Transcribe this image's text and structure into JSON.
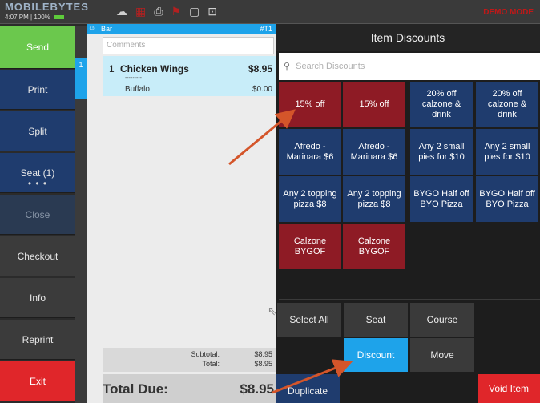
{
  "topbar": {
    "brand": "MOBILEBYTES",
    "time": "4:07 PM",
    "battery_pct": "100%",
    "mode": "DEMO MODE",
    "icons": [
      "cloud-upload-icon",
      "grid-icon",
      "printer-icon",
      "flag-icon",
      "chat-icon",
      "terminal-icon"
    ]
  },
  "nav": {
    "send": "Send",
    "print": "Print",
    "split": "Split",
    "seat": "Seat (1)",
    "seat_more": "• • •",
    "close": "Close",
    "checkout": "Checkout",
    "info": "Info",
    "reprint": "Reprint",
    "exit": "Exit"
  },
  "seat_strip": {
    "active_seat": "1"
  },
  "order": {
    "location": "Bar",
    "table": "#T1",
    "comments_placeholder": "Comments",
    "items": [
      {
        "qty": "1",
        "name": "Chicken Wings",
        "price": "$8.95",
        "separator": "---------",
        "modifier": "Buffalo",
        "modifier_price": "$0.00"
      }
    ],
    "subtotal_label": "Subtotal:",
    "subtotal": "$8.95",
    "total_label": "Total:",
    "total": "$8.95",
    "total_due_label": "Total Due:",
    "total_due": "$8.95"
  },
  "discounts": {
    "title": "Item Discounts",
    "search_placeholder": "Search Discounts",
    "tiles": [
      {
        "label": "15% off",
        "color": "#8e1b25"
      },
      {
        "label": "15% off",
        "color": "#8e1b25"
      },
      {
        "label": "20% off calzone & drink",
        "color": "#1f3c6e"
      },
      {
        "label": "20% off calzone & drink",
        "color": "#1f3c6e"
      },
      {
        "label": "Afredo - Marinara $6",
        "color": "#1f3c6e"
      },
      {
        "label": "Afredo - Marinara $6",
        "color": "#1f3c6e"
      },
      {
        "label": "Any 2 small pies for $10",
        "color": "#1f3c6e"
      },
      {
        "label": "Any 2 small pies for $10",
        "color": "#1f3c6e"
      },
      {
        "label": "Any 2 topping pizza $8",
        "color": "#1f3c6e"
      },
      {
        "label": "Any 2 topping pizza $8",
        "color": "#1f3c6e"
      },
      {
        "label": "BYGO Half off BYO Pizza",
        "color": "#1f3c6e"
      },
      {
        "label": "BYGO Half off BYO Pizza",
        "color": "#1f3c6e"
      },
      {
        "label": "Calzone BYGOF",
        "color": "#8e1b25"
      },
      {
        "label": "Calzone BYGOF",
        "color": "#8e1b25"
      }
    ],
    "actions": {
      "select_all": "Select All",
      "seat": "Seat",
      "course": "Course",
      "discount": "Discount",
      "move": "Move",
      "duplicate": "Duplicate",
      "void_item": "Void Item"
    }
  },
  "colors": {
    "accent_blue": "#1ea3ea",
    "send_green": "#6bc84d",
    "exit_red": "#e0262a",
    "navy": "#1f3c6e",
    "maroon": "#8e1b25",
    "arrow": "#d4552a"
  }
}
